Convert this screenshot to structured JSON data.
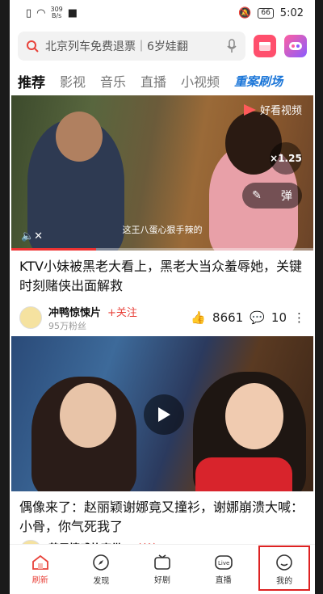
{
  "statusbar": {
    "net_speed": "309",
    "net_unit": "B/s",
    "battery": "66",
    "time": "5:02"
  },
  "search": {
    "placeholder_text": "北京列车免费退票｜6岁娃翻"
  },
  "tabs": [
    {
      "label": "推荐",
      "active": true
    },
    {
      "label": "影视"
    },
    {
      "label": "音乐"
    },
    {
      "label": "直播"
    },
    {
      "label": "小视频"
    },
    {
      "label": "重案刷场",
      "special": true
    }
  ],
  "card1": {
    "brand": "好看视频",
    "speed": "×1.25",
    "danmaku": "弹",
    "subtitle": "这王八蛋心狠手辣的",
    "title": "KTV小妹被黑老大看上，黑老大当众羞辱她，关键时刻赌侠出面解救",
    "author": "冲鸭惊悚片",
    "follow": "+关注",
    "fans": "95万粉丝",
    "likes": "8661",
    "comments": "10"
  },
  "card2": {
    "title": "偶像来了：赵丽颖谢娜竟又撞衫，谢娜崩溃大喊：小骨，你气死我了",
    "author": "英里情感故事带",
    "follow": "+关注"
  },
  "nav": [
    {
      "label": "刷新",
      "icon": "home-icon",
      "active": true
    },
    {
      "label": "发现",
      "icon": "compass-icon"
    },
    {
      "label": "好剧",
      "icon": "tv-icon"
    },
    {
      "label": "直播",
      "icon": "live-icon"
    },
    {
      "label": "我的",
      "icon": "smile-icon"
    }
  ],
  "colors": {
    "accent": "#e8423a",
    "special_tab": "#1b76d8"
  }
}
